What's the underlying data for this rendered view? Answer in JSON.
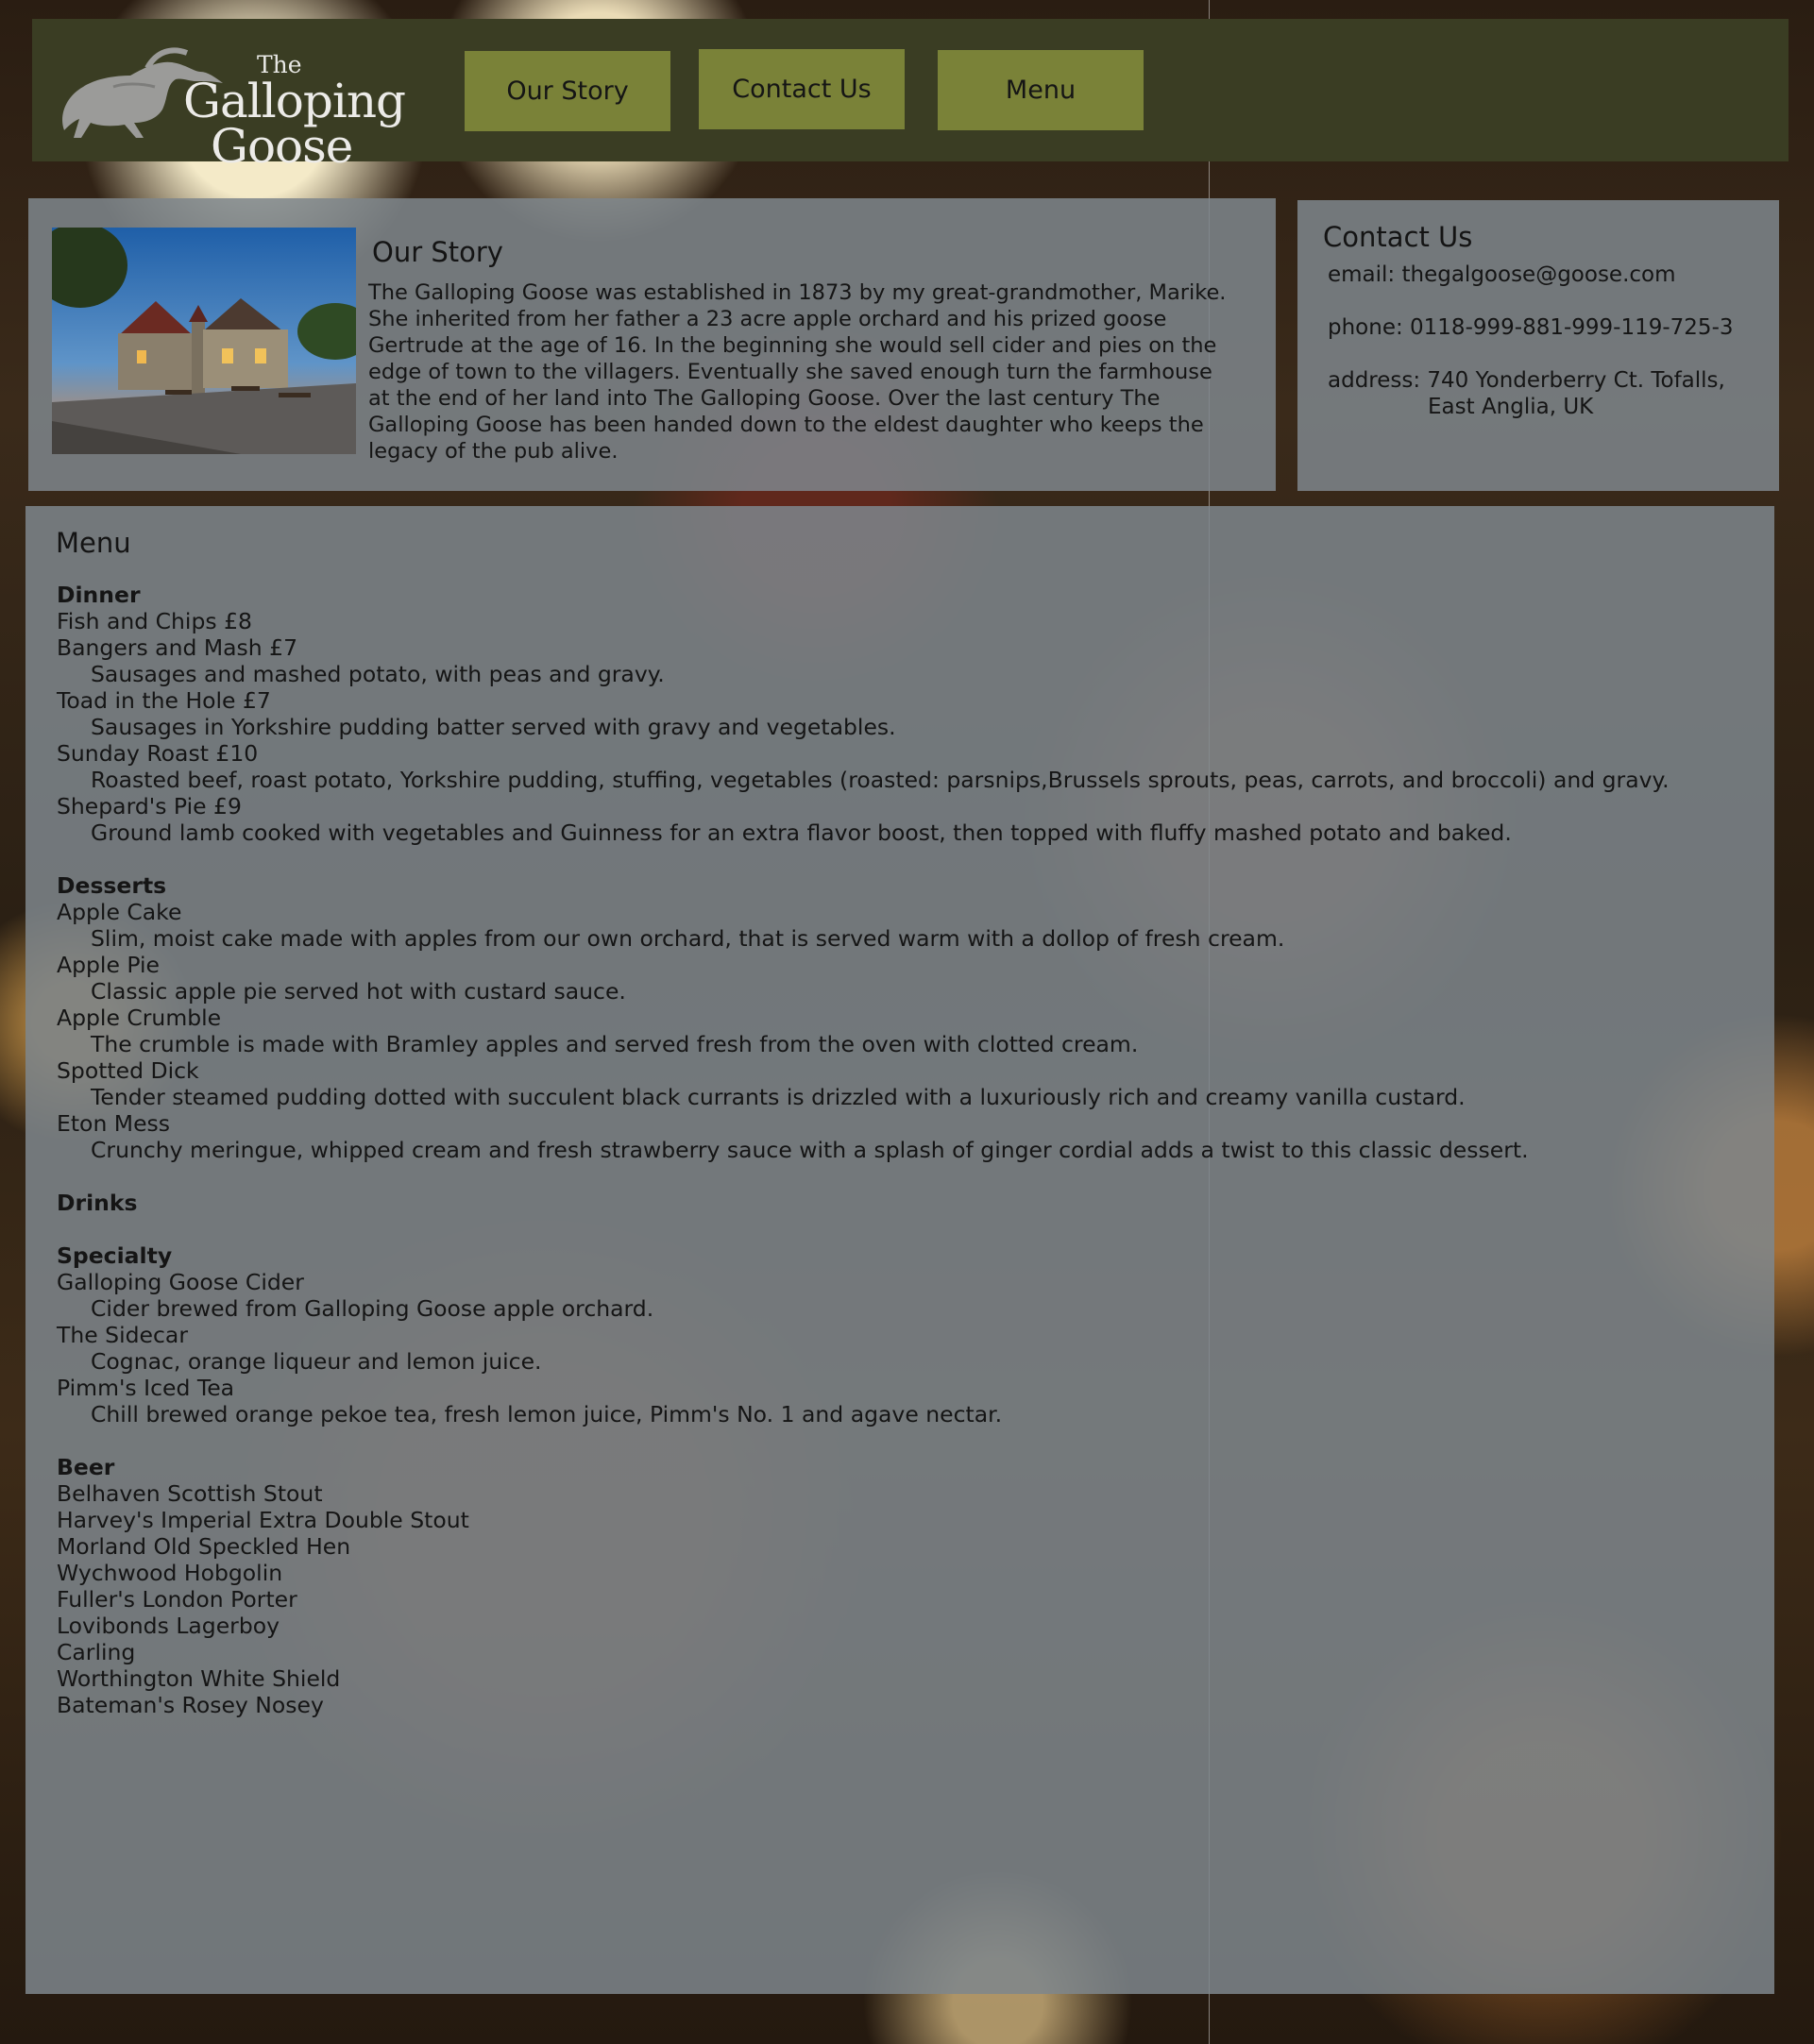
{
  "brand": {
    "line1": "The",
    "line2": "Galloping",
    "line3": "Goose"
  },
  "nav": [
    {
      "label": "Our Story"
    },
    {
      "label": "Contact Us"
    },
    {
      "label": "Menu"
    }
  ],
  "story": {
    "title": "Our Story",
    "body": "The Galloping Goose was established in 1873 by my great-grandmother, Marike. She inherited from her father a 23 acre apple orchard and his prized goose Gertrude at the age of 16. In the beginning she would sell cider and pies on the edge of town to the villagers. Eventually she saved enough turn the farmhouse at the end of her land into The Galloping Goose. Over the last century The Galloping Goose has been handed down to the eldest daughter who keeps the legacy of the pub alive."
  },
  "contact": {
    "title": "Contact Us",
    "email": "email: thegalgoose@goose.com",
    "phone": "phone: 0118-999-881-999-119-725-3",
    "address_line1": "address: 740 Yonderberry Ct. Tofalls,",
    "address_line2": "East Anglia, UK"
  },
  "menu": {
    "title": "Menu",
    "dinner": {
      "heading": "Dinner",
      "items": [
        {
          "name": "Fish and Chips £8",
          "desc": ""
        },
        {
          "name": "Bangers and Mash £7",
          "desc": "Sausages and mashed potato, with peas and gravy."
        },
        {
          "name": "Toad in the Hole £7",
          "desc": "Sausages in Yorkshire pudding batter served with gravy and vegetables."
        },
        {
          "name": "Sunday Roast £10",
          "desc": "Roasted beef, roast potato, Yorkshire pudding, stuffing, vegetables (roasted: parsnips,Brussels sprouts, peas, carrots, and broccoli) and gravy."
        },
        {
          "name": "Shepard's Pie £9",
          "desc": "Ground lamb cooked with vegetables and Guinness for an extra flavor boost, then topped with fluffy mashed potato and baked."
        }
      ]
    },
    "desserts": {
      "heading": "Desserts",
      "items": [
        {
          "name": "Apple Cake",
          "desc": "Slim, moist cake made with apples from our own orchard, that is served warm with a dollop of fresh cream."
        },
        {
          "name": "Apple Pie",
          "desc": "Classic apple pie served hot with custard sauce."
        },
        {
          "name": "Apple Crumble",
          "desc": "The crumble is made with Bramley apples and served fresh from the oven with clotted cream."
        },
        {
          "name": "Spotted Dick",
          "desc": "Tender steamed pudding dotted with succulent black currants is drizzled with a luxuriously rich and creamy vanilla custard."
        },
        {
          "name": "Eton Mess",
          "desc": "Crunchy meringue, whipped cream and fresh strawberry sauce with a splash of ginger cordial adds a twist to this classic dessert."
        }
      ]
    },
    "drinks": {
      "heading": "Drinks",
      "specialty_heading": "Specialty",
      "specialty": [
        {
          "name": "Galloping Goose Cider",
          "desc": "Cider brewed from Galloping Goose apple orchard."
        },
        {
          "name": "The Sidecar",
          "desc": "Cognac, orange liqueur and lemon juice."
        },
        {
          "name": "Pimm's Iced Tea",
          "desc": "Chill brewed orange pekoe tea, fresh lemon juice, Pimm's No. 1 and agave nectar."
        }
      ],
      "beer_heading": "Beer",
      "beer": [
        "Belhaven Scottish Stout",
        "Harvey's Imperial Extra Double Stout",
        "Morland Old Speckled Hen",
        "Wychwood Hobgolin",
        "Fuller's London Porter",
        "Lovibonds Lagerboy",
        "Carling",
        "Worthington White Shield",
        "Bateman's Rosey Nosey"
      ]
    }
  },
  "icons": {
    "logo": "goose-logo-icon"
  },
  "colors": {
    "header_bg": "#3a3d23",
    "nav_button": "#7a8238",
    "panel": "#7e868c"
  }
}
